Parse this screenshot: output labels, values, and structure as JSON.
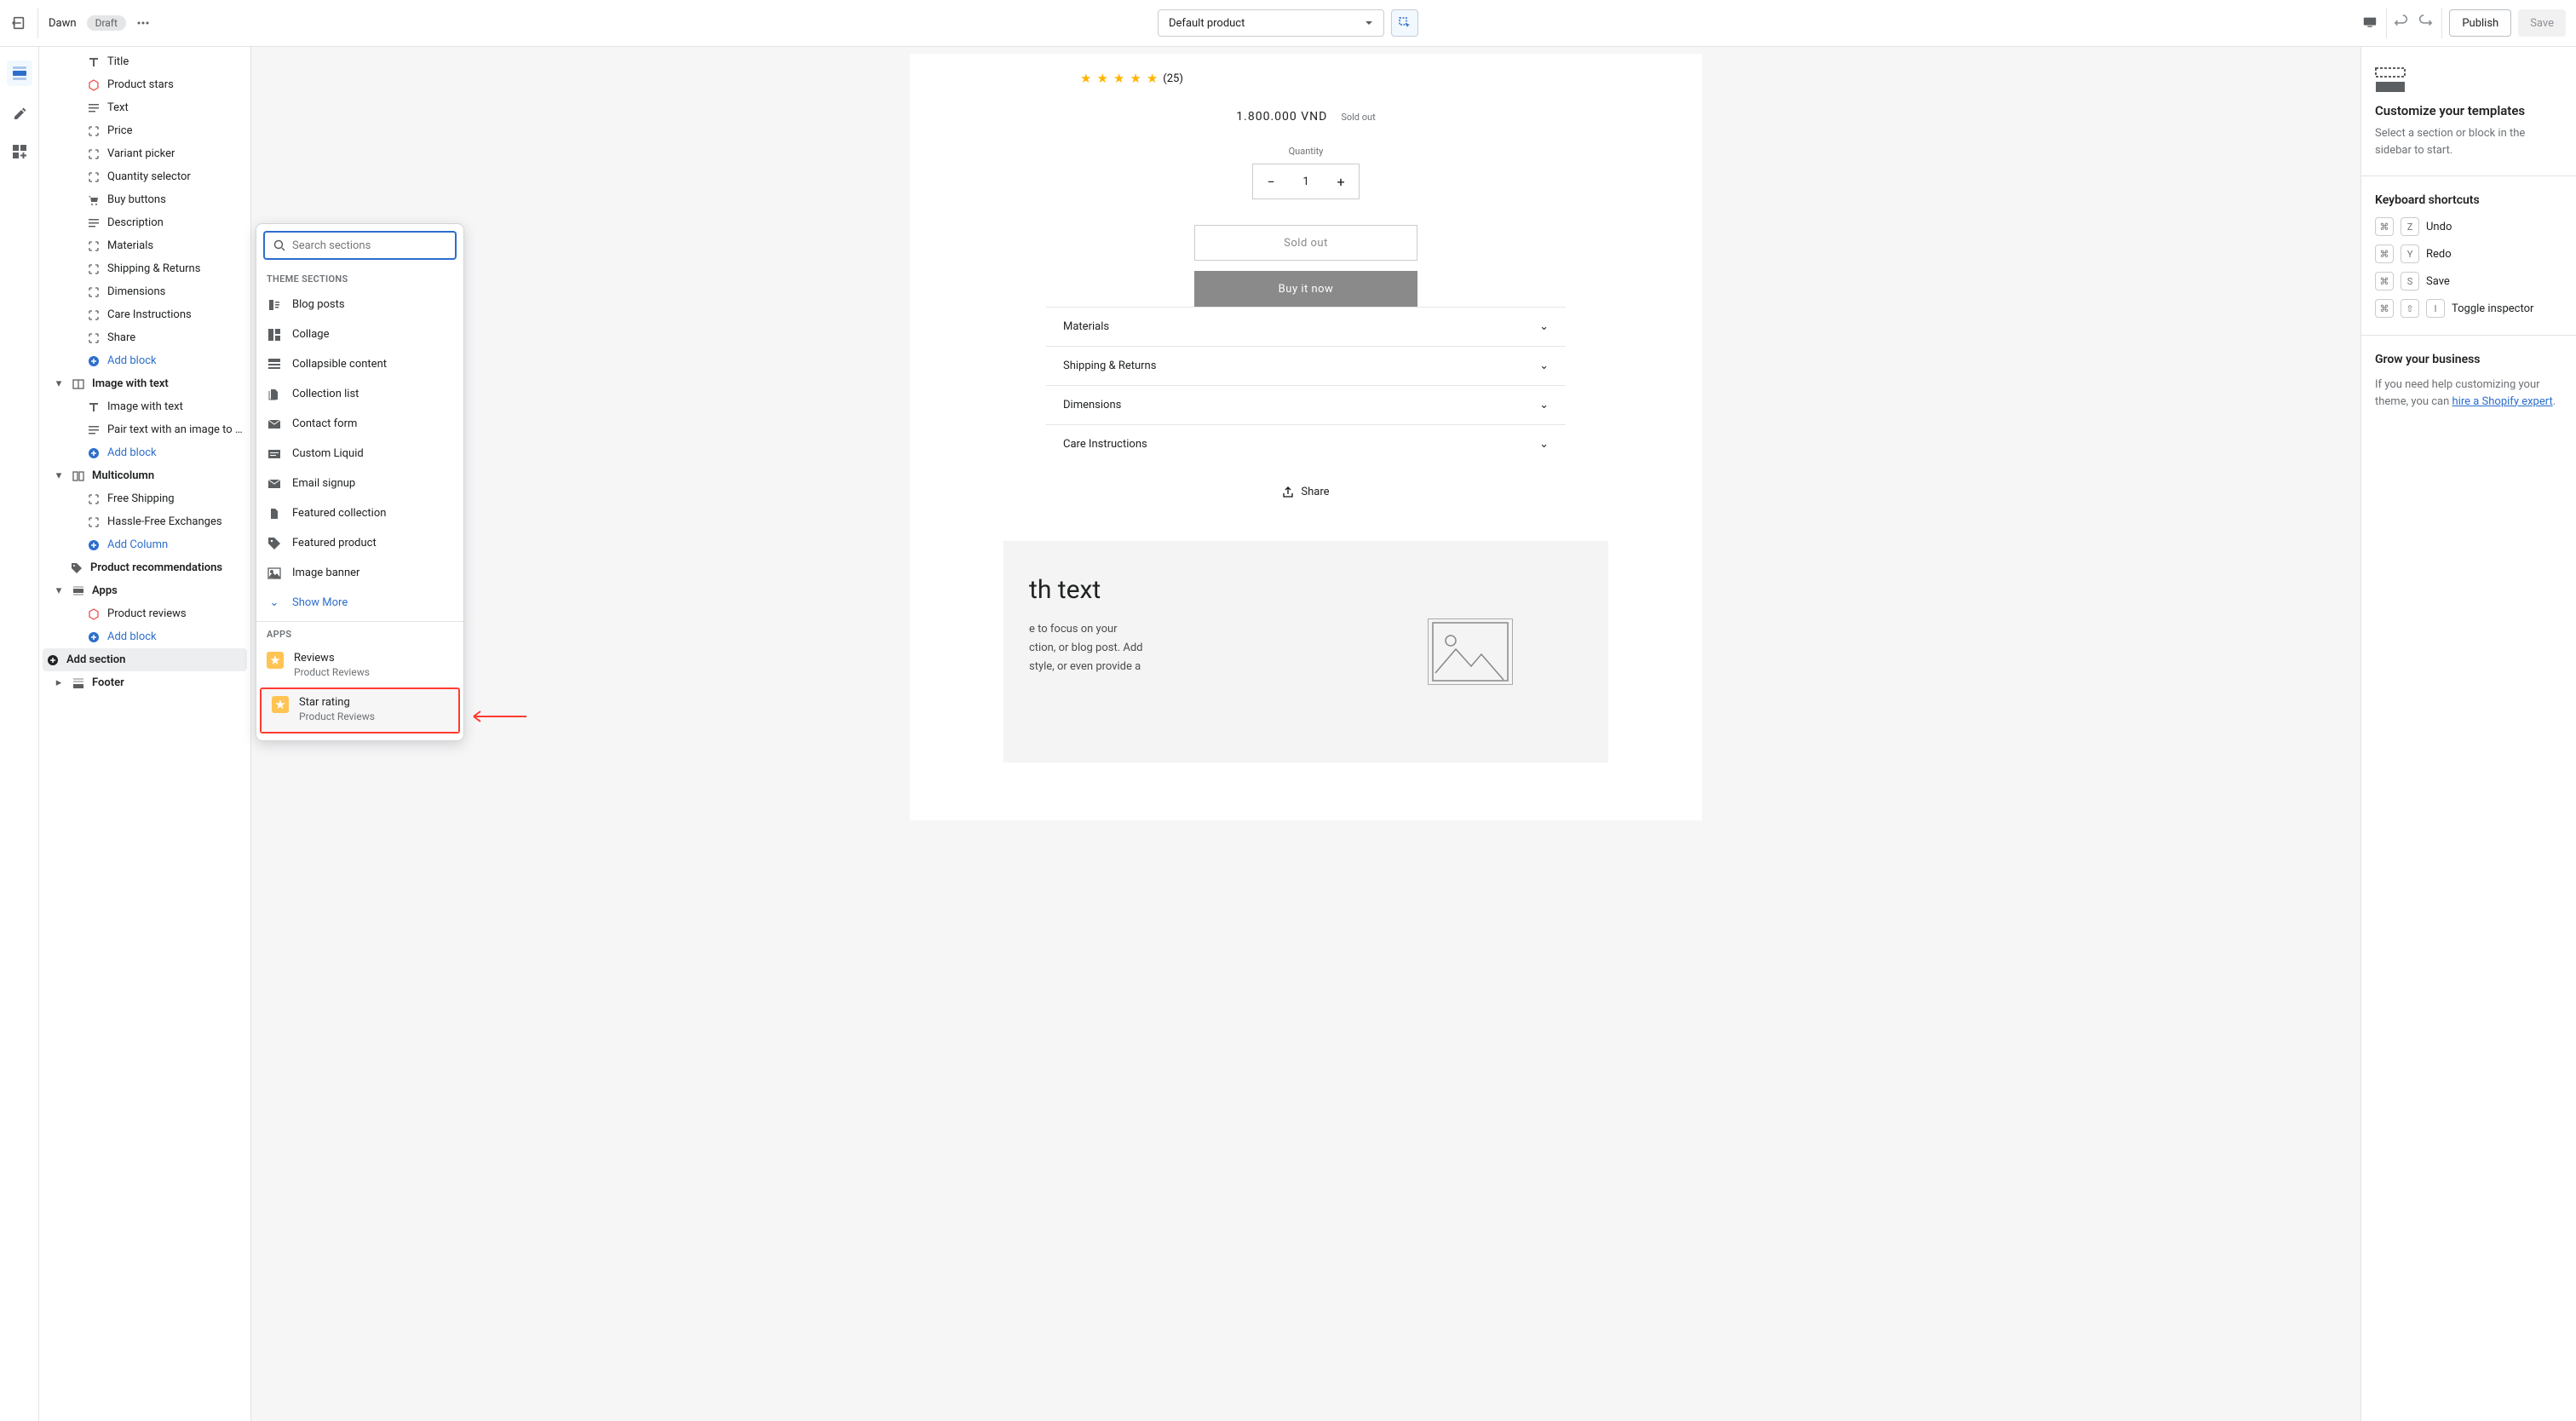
{
  "topbar": {
    "theme_name": "Dawn",
    "badge": "Draft",
    "template": "Default product",
    "publish": "Publish",
    "save": "Save"
  },
  "tree": {
    "title": "Title",
    "product_stars": "Product stars",
    "text": "Text",
    "price": "Price",
    "variant_picker": "Variant picker",
    "quantity_selector": "Quantity selector",
    "buy_buttons": "Buy buttons",
    "description": "Description",
    "materials": "Materials",
    "shipping_returns": "Shipping & Returns",
    "dimensions": "Dimensions",
    "care_instructions": "Care Instructions",
    "share": "Share",
    "add_block": "Add block",
    "image_with_text": "Image with text",
    "image_with_text_block": "Image with text",
    "pair_text": "Pair text with an image to fo...",
    "multicolumn": "Multicolumn",
    "free_shipping": "Free Shipping",
    "hassle_free": "Hassle-Free Exchanges",
    "add_column": "Add Column",
    "product_recs": "Product recommendations",
    "apps": "Apps",
    "product_reviews": "Product reviews",
    "add_section": "Add section",
    "footer": "Footer"
  },
  "popover": {
    "search_placeholder": "Search sections",
    "theme_sections": "THEME SECTIONS",
    "items": [
      "Blog posts",
      "Collage",
      "Collapsible content",
      "Collection list",
      "Contact form",
      "Custom Liquid",
      "Email signup",
      "Featured collection",
      "Featured product",
      "Image banner"
    ],
    "show_more": "Show More",
    "apps": "APPS",
    "reviews": "Reviews",
    "star_rating": "Star rating",
    "product_reviews": "Product Reviews"
  },
  "preview": {
    "review_count": "(25)",
    "price": "1.800.000 VND",
    "sold_out": "Sold out",
    "quantity": "Quantity",
    "qty_value": "1",
    "sold_out_btn": "Sold out",
    "buy_now": "Buy it now",
    "accordions": [
      "Materials",
      "Shipping & Returns",
      "Dimensions",
      "Care Instructions"
    ],
    "share": "Share",
    "imgtext_h": "th text",
    "imgtext_p1": "e to focus on your",
    "imgtext_p2": "ction, or blog post. Add",
    "imgtext_p3": "style, or even provide a"
  },
  "rightpanel": {
    "customize_h": "Customize your templates",
    "customize_p": "Select a section or block in the sidebar to start.",
    "shortcuts_h": "Keyboard shortcuts",
    "undo": "Undo",
    "redo": "Redo",
    "save": "Save",
    "toggle_inspector": "Toggle inspector",
    "grow_h": "Grow your business",
    "grow_p1": "If you need help customizing your theme, you can ",
    "grow_link": "hire a Shopify expert"
  }
}
